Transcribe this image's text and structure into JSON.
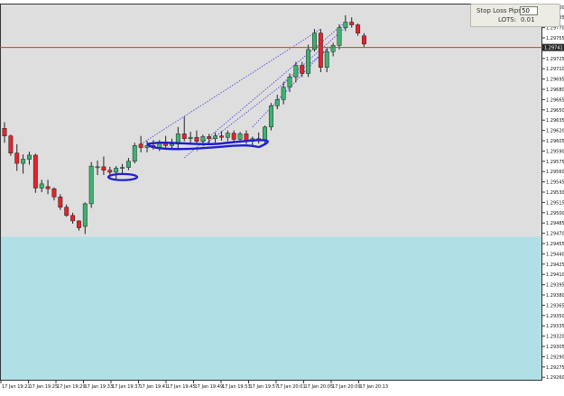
{
  "chart_data": {
    "type": "candlestick",
    "symbol_box": "1.29741",
    "x_ticks": [
      "17 Jan 19:21",
      "17 Jan 19:25",
      "17 Jan 19:29",
      "17 Jan 19:33",
      "17 Jan 19:37",
      "17 Jan 19:41",
      "17 Jan 19:45",
      "17 Jan 19:49",
      "17 Jan 19:53",
      "17 Jan 19:57",
      "17 Jan 20:01",
      "17 Jan 20:05",
      "17 Jan 20:09",
      "17 Jan 20:13"
    ],
    "y_ticks": [
      "1.29800",
      "1.29785",
      "1.29770",
      "1.29755",
      "1.29740",
      "1.29725",
      "1.29710",
      "1.29695",
      "1.29680",
      "1.29665",
      "1.29650",
      "1.29635",
      "1.29620",
      "1.29605",
      "1.29590",
      "1.29575",
      "1.29560",
      "1.29545",
      "1.29530",
      "1.29515",
      "1.29500",
      "1.29485",
      "1.29470",
      "1.29455",
      "1.29440",
      "1.29425",
      "1.29410",
      "1.29395",
      "1.29380",
      "1.29365",
      "1.29350",
      "1.29335",
      "1.29320",
      "1.29305",
      "1.29290",
      "1.29275",
      "1.29260"
    ],
    "ylim": [
      1.29255,
      1.29805
    ],
    "current_price": 1.29741,
    "shaded_zone": [
      1.29255,
      1.29465
    ],
    "colors": {
      "background": "#dedede",
      "zone": "#b0e0e6",
      "bull": "#3cb371",
      "bear": "#e8212a",
      "price_line": "#e03030",
      "wick": "#222222",
      "drawing": "#1e1ed2",
      "trendline": "#3c3cdc"
    },
    "candles": [
      [
        1.29623,
        1.29632,
        1.29602,
        1.29612
      ],
      [
        1.29612,
        1.29614,
        1.29583,
        1.29587
      ],
      [
        1.29587,
        1.296,
        1.29561,
        1.29572
      ],
      [
        1.29572,
        1.29585,
        1.29557,
        1.29578
      ],
      [
        1.29578,
        1.29589,
        1.2957,
        1.29584
      ],
      [
        1.29584,
        1.29586,
        1.29529,
        1.29536
      ],
      [
        1.29536,
        1.29548,
        1.2953,
        1.29542
      ],
      [
        1.29538,
        1.29548,
        1.29527,
        1.29535
      ],
      [
        1.29535,
        1.29537,
        1.29518,
        1.29523
      ],
      [
        1.29523,
        1.29527,
        1.29504,
        1.29508
      ],
      [
        1.29508,
        1.29512,
        1.29494,
        1.29496
      ],
      [
        1.29496,
        1.295,
        1.29484,
        1.29488
      ],
      [
        1.29488,
        1.29489,
        1.29474,
        1.29478
      ],
      [
        1.2948,
        1.29515,
        1.29469,
        1.29513
      ],
      [
        1.29513,
        1.29574,
        1.29507,
        1.29568
      ],
      [
        1.29566,
        1.29576,
        1.29555,
        1.29567
      ],
      [
        1.29567,
        1.29582,
        1.29555,
        1.29562
      ],
      [
        1.29562,
        1.29567,
        1.29552,
        1.29559
      ],
      [
        1.29559,
        1.29568,
        1.29549,
        1.29565
      ],
      [
        1.29565,
        1.29571,
        1.29556,
        1.29566
      ],
      [
        1.29566,
        1.2958,
        1.29562,
        1.29575
      ],
      [
        1.29575,
        1.29602,
        1.29572,
        1.29598
      ],
      [
        1.296,
        1.29612,
        1.29588,
        1.29595
      ],
      [
        1.29595,
        1.29605,
        1.29588,
        1.29598
      ],
      [
        1.29598,
        1.29606,
        1.29592,
        1.29595
      ],
      [
        1.29595,
        1.29606,
        1.2959,
        1.29603
      ],
      [
        1.29603,
        1.29612,
        1.29595,
        1.29598
      ],
      [
        1.29598,
        1.29608,
        1.29592,
        1.296
      ],
      [
        1.296,
        1.29625,
        1.29592,
        1.29615
      ],
      [
        1.29615,
        1.2964,
        1.29604,
        1.29608
      ],
      [
        1.29608,
        1.29618,
        1.296,
        1.2961
      ],
      [
        1.2961,
        1.2962,
        1.29601,
        1.29604
      ],
      [
        1.29604,
        1.29614,
        1.29598,
        1.29611
      ],
      [
        1.29611,
        1.29615,
        1.29601,
        1.29608
      ],
      [
        1.29608,
        1.29617,
        1.29602,
        1.29612
      ],
      [
        1.29612,
        1.29619,
        1.29605,
        1.2961
      ],
      [
        1.2961,
        1.2962,
        1.29604,
        1.29616
      ],
      [
        1.29616,
        1.2962,
        1.29603,
        1.29607
      ],
      [
        1.29607,
        1.29618,
        1.29602,
        1.29615
      ],
      [
        1.29615,
        1.2962,
        1.296,
        1.29604
      ],
      [
        1.29604,
        1.29611,
        1.29596,
        1.29608
      ],
      [
        1.29608,
        1.29617,
        1.29601,
        1.29605
      ],
      [
        1.29605,
        1.29627,
        1.296,
        1.29625
      ],
      [
        1.29625,
        1.2966,
        1.2962,
        1.29656
      ],
      [
        1.29656,
        1.29672,
        1.29651,
        1.29665
      ],
      [
        1.29665,
        1.2969,
        1.29658,
        1.29683
      ],
      [
        1.29683,
        1.29703,
        1.29676,
        1.29698
      ],
      [
        1.29698,
        1.2972,
        1.2969,
        1.29715
      ],
      [
        1.29715,
        1.2972,
        1.29698,
        1.29703
      ],
      [
        1.29703,
        1.29745,
        1.29698,
        1.29738
      ],
      [
        1.29738,
        1.29768,
        1.29735,
        1.29762
      ],
      [
        1.29762,
        1.29768,
        1.29705,
        1.29712
      ],
      [
        1.29712,
        1.2974,
        1.29705,
        1.29735
      ],
      [
        1.29735,
        1.29748,
        1.29728,
        1.29744
      ],
      [
        1.29744,
        1.29775,
        1.29738,
        1.2977
      ],
      [
        1.2977,
        1.29788,
        1.29765,
        1.29778
      ],
      [
        1.29778,
        1.29785,
        1.2977,
        1.29774
      ],
      [
        1.29774,
        1.29776,
        1.29758,
        1.29762
      ],
      [
        1.29758,
        1.29762,
        1.29742,
        1.29746
      ]
    ],
    "trendlines": [
      [
        [
          22,
          1.296
        ],
        [
          51,
          1.29768
        ]
      ],
      [
        [
          29,
          1.2958
        ],
        [
          55,
          1.29778
        ]
      ],
      [
        [
          31,
          1.2959
        ],
        [
          53,
          1.29744
        ]
      ],
      [
        [
          40,
          1.29625
        ],
        [
          52,
          1.2974
        ]
      ],
      [
        [
          45,
          1.2969
        ],
        [
          55,
          1.2977
        ]
      ]
    ]
  },
  "panel": {
    "sl_label": "Stop Loss Pips:",
    "sl_value": "50",
    "lots_label": "LOTS:",
    "lots_value": "0.01"
  }
}
